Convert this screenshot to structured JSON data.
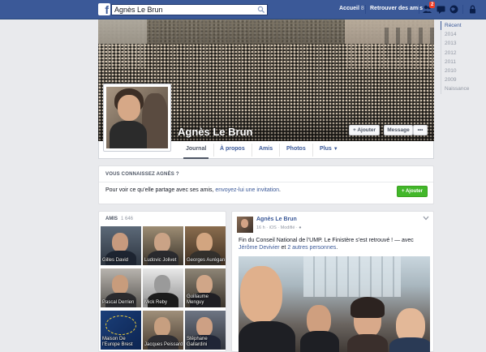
{
  "topbar": {
    "search_value": "Agnès Le Brun",
    "nav_home": "Accueil",
    "nav_home_count": "8",
    "nav_find_friends": "Retrouver des amis",
    "notification_badge": "2",
    "brand_color": "#3b5998"
  },
  "timeline_years": [
    "Récent",
    "2014",
    "2013",
    "2012",
    "2011",
    "2010",
    "2009",
    "Naissance"
  ],
  "profile": {
    "name": "Agnès Le Brun",
    "add_friend_label": "Ajouter",
    "message_label": "Message",
    "more_label": "•••"
  },
  "tabs": [
    "Journal",
    "À propos",
    "Amis",
    "Photos",
    "Plus"
  ],
  "know": {
    "title": "VOUS CONNAISSEZ AGNÈS ?",
    "text_before": "Pour voir ce qu’elle partage avec ses amis, ",
    "link": "envoyez-lui une invitation",
    "text_after": ".",
    "add_button": "Ajouter"
  },
  "friends": {
    "title": "AMIS",
    "count": "1 646",
    "items": [
      {
        "name": "Gilles David"
      },
      {
        "name": "Ludovic Jolivet"
      },
      {
        "name": "Georges Aurégan"
      },
      {
        "name": "Pascal Derrien"
      },
      {
        "name": "Mick Reby"
      },
      {
        "name": "Guillaume Menguy"
      },
      {
        "name": "Maison De l'Europe Brest"
      },
      {
        "name": "Jacques Peissard"
      },
      {
        "name": "Stéphane Gallardini"
      }
    ]
  },
  "post": {
    "author": "Agnès Le Brun",
    "meta": "16 h · iOS · Modifié ·",
    "text_main": "Fin du Conseil National de l’UMP. Le Finistère s’est retrouvé ! — avec",
    "tagged_person": "Jérôme Devivier",
    "text_and": " et ",
    "tagged_others": "2 autres personnes",
    "text_end": "."
  }
}
